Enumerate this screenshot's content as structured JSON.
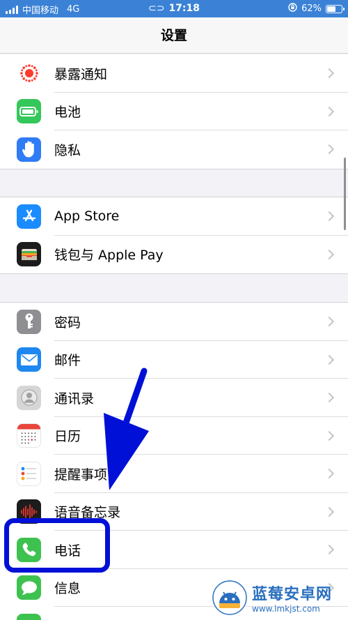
{
  "status_bar": {
    "carrier": "中国移动",
    "network": "4G",
    "time": "17:18",
    "battery_text": "62%",
    "battery_level": 0.62
  },
  "nav": {
    "title": "设置"
  },
  "groups": [
    [
      {
        "label": "暴露通知",
        "icon": "exposure-notification-icon"
      },
      {
        "label": "电池",
        "icon": "battery-icon"
      },
      {
        "label": "隐私",
        "icon": "privacy-hand-icon"
      }
    ],
    [
      {
        "label": "App Store",
        "icon": "app-store-icon"
      },
      {
        "label": "钱包与 Apple Pay",
        "icon": "wallet-icon"
      }
    ],
    [
      {
        "label": "密码",
        "icon": "key-icon"
      },
      {
        "label": "邮件",
        "icon": "mail-icon"
      },
      {
        "label": "通讯录",
        "icon": "contacts-icon"
      },
      {
        "label": "日历",
        "icon": "calendar-icon"
      },
      {
        "label": "提醒事项",
        "icon": "reminders-icon"
      },
      {
        "label": "语音备忘录",
        "icon": "voice-memos-icon"
      },
      {
        "label": "电话",
        "icon": "phone-icon"
      },
      {
        "label": "信息",
        "icon": "messages-icon"
      },
      {
        "label": "",
        "icon": "facetime-icon"
      }
    ]
  ],
  "watermark": {
    "title": "蓝莓安卓网",
    "url": "www.lmkjst.com"
  },
  "colors": {
    "status_bar": "#3b82d6",
    "annotation_blue": "#0010d6",
    "exposure": "#ff3b30",
    "battery": "#34c759",
    "privacy": "#2f7cf6",
    "app_store": "#1a8cff",
    "wallet": "#1c1c1e",
    "passwords": "#8e8e93",
    "mail": "#1e88f0",
    "contacts": "#d6d6d6",
    "phone": "#3ec24f",
    "messages": "#3ec24f"
  }
}
